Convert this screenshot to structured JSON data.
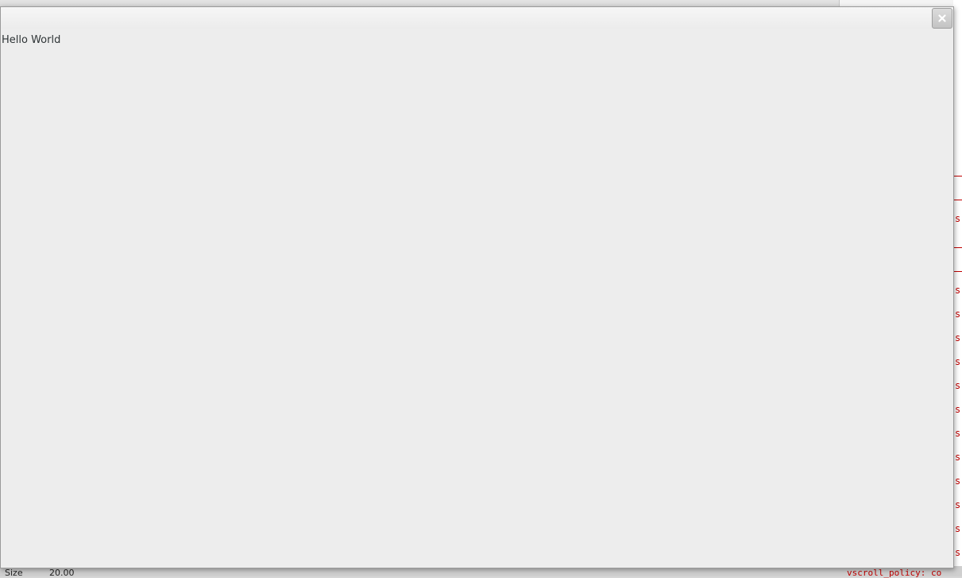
{
  "window": {
    "label_text": "Hello World",
    "close_glyph": "×"
  },
  "background": {
    "size_label": "Size",
    "size_value": "20.00",
    "code_char": "s",
    "code_fragment": "vscroll_policy: co"
  },
  "colors": {
    "window_bg": "#ededed",
    "text": "#2e3436",
    "code_red": "#c00000"
  }
}
